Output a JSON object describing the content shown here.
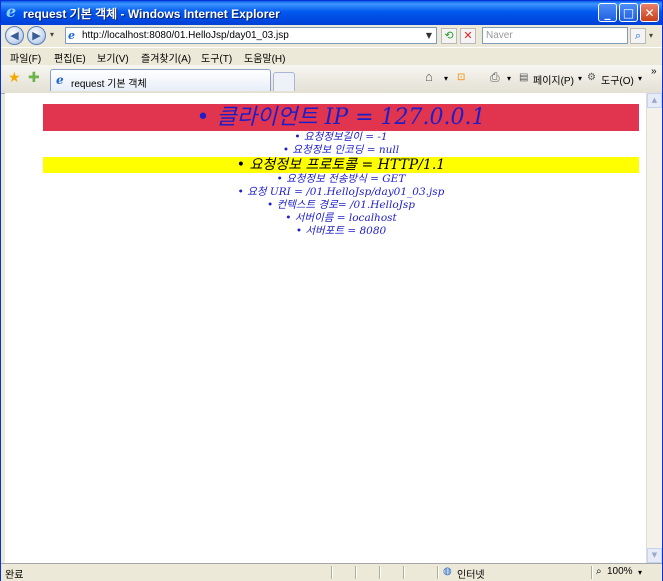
{
  "window": {
    "title": "request 기본 객체 - Windows Internet Explorer",
    "min_btn": "_",
    "max_btn": "□",
    "close_btn": "✕"
  },
  "address": {
    "url": "http://localhost:8080/01.HelloJsp/day01_03.jsp",
    "search_placeholder": "Naver"
  },
  "menu": [
    "파일(F)",
    "편집(E)",
    "보기(V)",
    "즐겨찾기(A)",
    "도구(T)",
    "도움말(H)"
  ],
  "tab": {
    "title": "request 기본 객체"
  },
  "commandbar": {
    "page_label": "페이지(P)",
    "tools_label": "도구(O)"
  },
  "page": {
    "items": [
      "클라이언트 IP = 127.0.0.1",
      "요청정보길이 = -1",
      "요청정보 인코딩 = null",
      "요청정보 프로토콜 = HTTP/1.1",
      "요청정보 전송방식 = GET",
      "요청 URI = /01.HelloJsp/day01_03.jsp",
      "컨텍스트 경로= /01.HelloJsp",
      "서버이름 = localhost",
      "서버포트 = 8080"
    ]
  },
  "status": {
    "left": "완료",
    "zone": "인터넷",
    "zoom": "100%"
  },
  "colors": {
    "highlight_red": "#e0344f",
    "highlight_yellow": "#ffff00",
    "text_blue": "#1e1ec8"
  }
}
